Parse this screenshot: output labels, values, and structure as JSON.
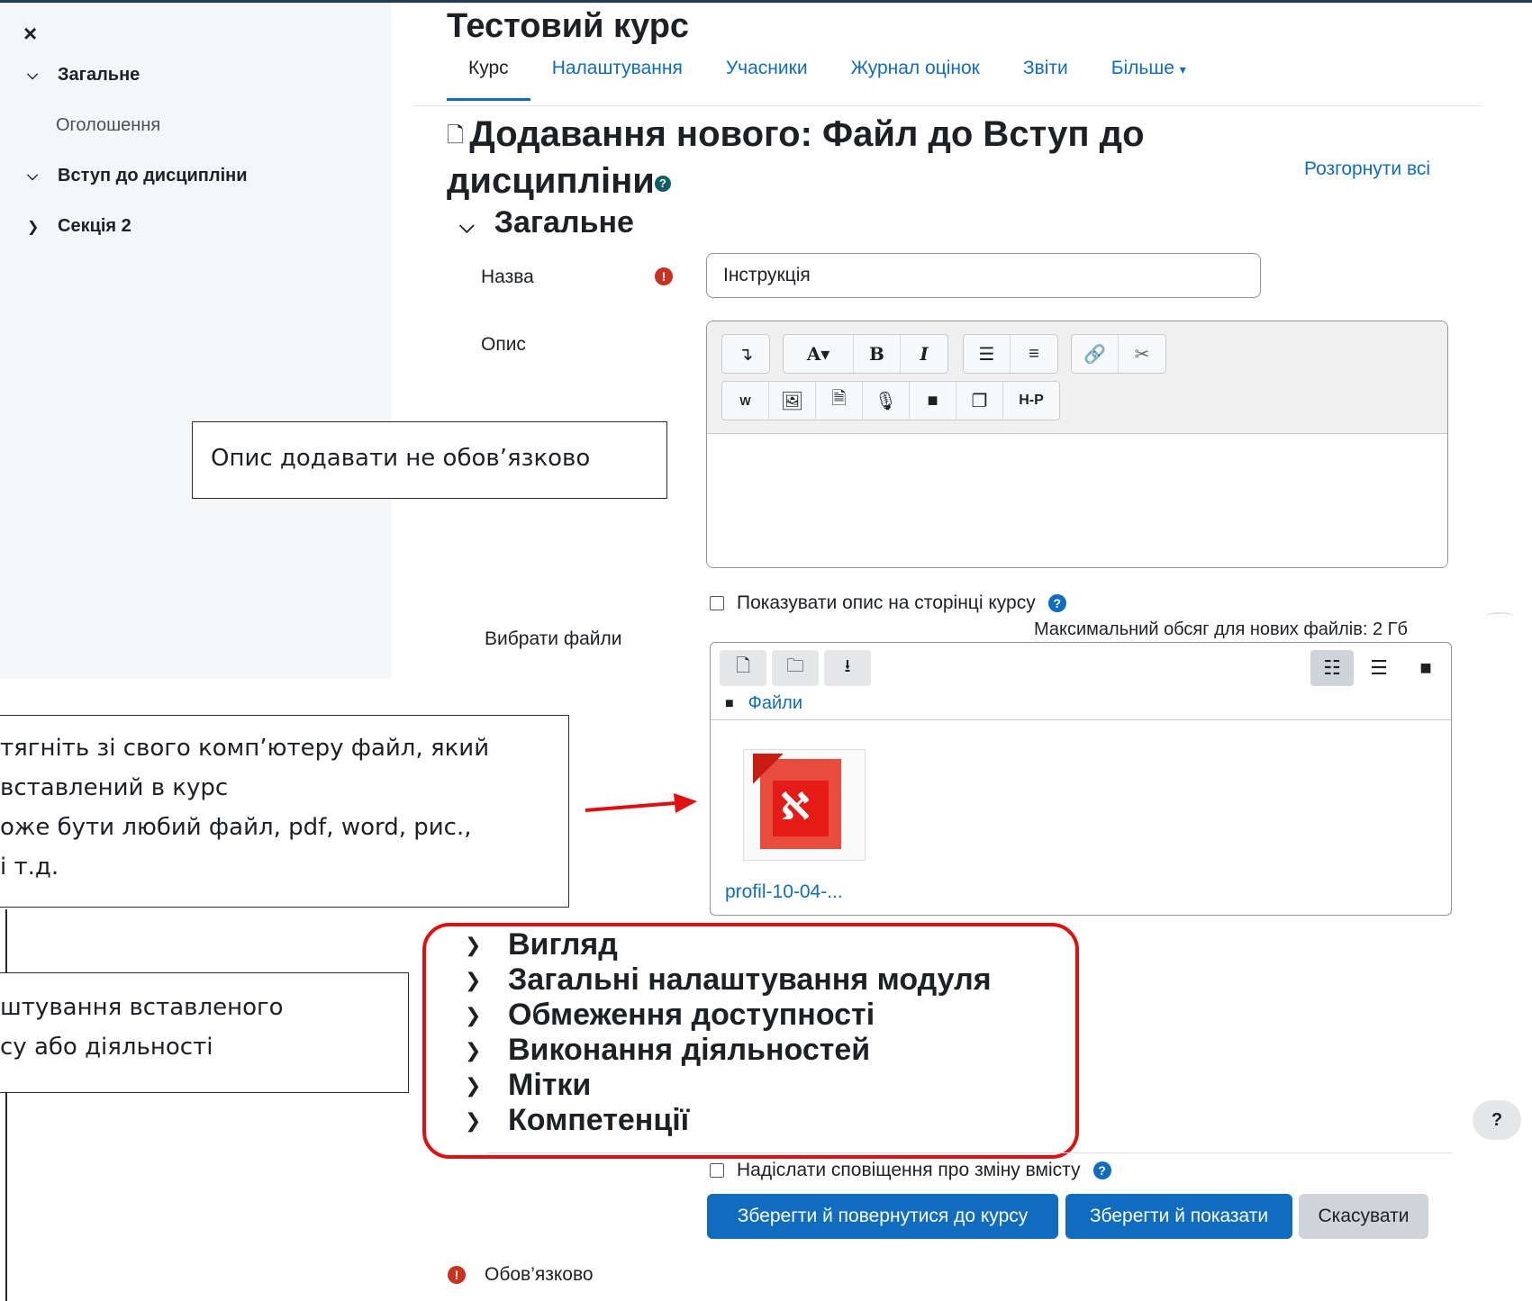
{
  "course": {
    "title": "Тестовий курс",
    "tabs": [
      "Курс",
      "Налаштування",
      "Учасники",
      "Журнал оцінок",
      "Звіти",
      "Більше"
    ],
    "more_chevron": "⌄"
  },
  "drawer": {
    "close_icon": "×",
    "items": [
      {
        "label": "Загальне",
        "state": "expanded"
      },
      {
        "label": "Оголошення"
      },
      {
        "label": "Вступ до дисципліни",
        "state": "expanded"
      },
      {
        "label": "Секція 2",
        "state": "collapsed"
      }
    ]
  },
  "page": {
    "heading_line1": "Додавання нового: Файл до Вступ до",
    "heading_line2": "дисципліни",
    "expand_all": "Розгорнути всі",
    "section_general": "Загальне"
  },
  "form": {
    "name_label": "Назва",
    "name_value": "Інструкція",
    "description_label": "Опис",
    "show_description_label": "Показувати опис на сторінці курсу",
    "select_files_label": "Вибрати файли",
    "max_size": "Максимальний обсяг для нових файлів: 2 Гб",
    "files_path": "Файли",
    "file_name": "profil-10-04-...",
    "notify_label": "Надіслати сповіщення про зміну вмісту",
    "required_label": "Обов’язково"
  },
  "editor_toolbar": {
    "row1": [
      "expand-icon",
      "font-color-icon",
      "bold-icon",
      "italic-icon",
      "bullet-list-icon",
      "numbered-list-icon",
      "link-icon",
      "unlink-icon"
    ],
    "row2": [
      "word-icon",
      "image-icon",
      "media-icon",
      "record-audio-icon",
      "record-video-icon",
      "manage-files-icon",
      "h5p-icon"
    ],
    "h5p_text": "H-P"
  },
  "collapsed_sections": [
    "Вигляд",
    "Загальні налаштування модуля",
    "Обмеження доступності",
    "Виконання діяльностей",
    "Мітки",
    "Компетенції"
  ],
  "buttons": {
    "save_return": "Зберегти й повернутися до курсу",
    "save_display": "Зберегти й показати",
    "cancel": "Скасувати"
  },
  "callouts": {
    "description": "Опис додавати не обов’язково",
    "file_lines": [
      "тягніть зі свого комп’ютеру файл, який",
      "вставлений в курс",
      "оже бути любий файл, pdf, word, рис.,",
      "і т.д."
    ],
    "settings_lines": [
      "штування вставленого",
      "су або діяльності"
    ]
  },
  "help_float": "?",
  "colors": {
    "accent": "#0f6cbf",
    "required": "#ca3120",
    "annotation_red": "#e01010"
  }
}
